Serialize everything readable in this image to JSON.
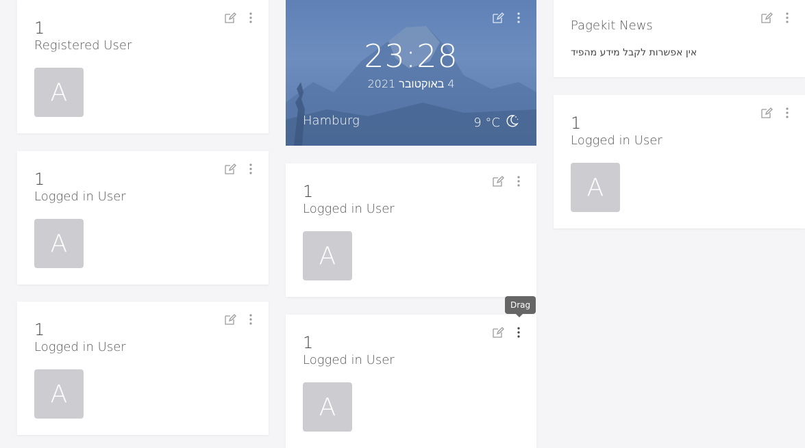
{
  "widgets": {
    "registered_users": {
      "count": "1",
      "label": "Registered User",
      "avatar_letter": "A"
    },
    "logged_in_1": {
      "count": "1",
      "label": "Logged in User",
      "avatar_letter": "A"
    },
    "logged_in_2": {
      "count": "1",
      "label": "Logged in User",
      "avatar_letter": "A"
    },
    "logged_in_3": {
      "count": "1",
      "label": "Logged in User",
      "avatar_letter": "A"
    },
    "logged_in_4": {
      "count": "1",
      "label": "Logged in User",
      "avatar_letter": "A"
    },
    "logged_in_5": {
      "count": "1",
      "label": "Logged in User",
      "avatar_letter": "A"
    }
  },
  "clock": {
    "time": "23:28",
    "date": "4 באוקטובר 2021",
    "city": "Hamburg",
    "temperature": "9 °C",
    "weather_icon": "moon-icon"
  },
  "news": {
    "title": "Pagekit News",
    "message": "אין אפשרות לקבל מידע מהפיד"
  },
  "tooltip": {
    "text": "Drag"
  },
  "icons": {
    "edit": "edit-icon",
    "drag": "more-vertical-icon"
  },
  "colors": {
    "avatar_bg": "#cdcdd1",
    "clock_bg": "#6d8dbe",
    "tooltip_bg": "#666666"
  }
}
